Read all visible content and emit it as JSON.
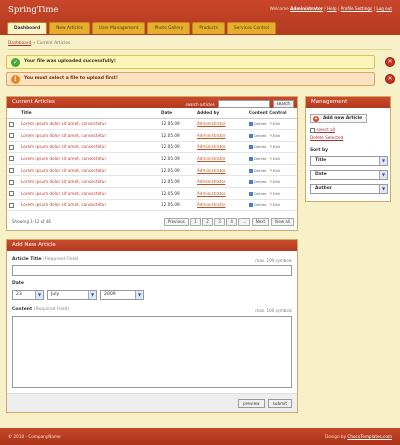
{
  "header": {
    "brand": "SpringTime",
    "welcome": "Welcome",
    "user": "Administrator",
    "sep": "|",
    "links": [
      "Help",
      "Profile Settings",
      "Log out"
    ]
  },
  "nav": {
    "tabs": [
      {
        "label": "Dashboard",
        "active": true
      },
      {
        "label": "New Articles",
        "active": false
      },
      {
        "label": "User Management",
        "active": false
      },
      {
        "label": "Photo Gallery",
        "active": false
      },
      {
        "label": "Products",
        "active": false
      },
      {
        "label": "Services Control",
        "active": false
      }
    ]
  },
  "breadcrumb": {
    "root": "Dashboard",
    "sep": "»",
    "current": "Current Articles"
  },
  "messages": {
    "success": "Your file was uploaded successfully!",
    "error": "You must select a file to upload first!",
    "ok_glyph": "✓",
    "err_glyph": "!",
    "close_glyph": "✕"
  },
  "articles": {
    "title": "Current Articles",
    "search_label": "search articles",
    "search_button": "search",
    "columns": [
      "Title",
      "Date",
      "Added by",
      "Content Control"
    ],
    "delete_label": "Delete",
    "edit_label": "Edit",
    "rows": [
      {
        "title": "Lorem ipsum dolor sit amet, consectetur",
        "date": "12.05.09",
        "author": "Administrator"
      },
      {
        "title": "Lorem ipsum dolor sit amet, consectetur",
        "date": "12.05.09",
        "author": "Administrator"
      },
      {
        "title": "Lorem ipsum dolor sit amet, consectetur",
        "date": "12.05.09",
        "author": "Administrator"
      },
      {
        "title": "Lorem ipsum dolor sit amet, consectetur",
        "date": "12.05.09",
        "author": "Administrator"
      },
      {
        "title": "Lorem ipsum dolor sit amet, consectetur",
        "date": "12.05.09",
        "author": "Administrator"
      },
      {
        "title": "Lorem ipsum dolor sit amet, consectetur",
        "date": "12.05.09",
        "author": "Administrator"
      },
      {
        "title": "Lorem ipsum dolor sit amet, consectetur",
        "date": "12.05.09",
        "author": "Administrator"
      },
      {
        "title": "Lorem ipsum dolor sit amet, consectetur",
        "date": "12.05.09",
        "author": "Administrator"
      }
    ],
    "pager_info": "Showing 1-12 of 48",
    "pager_buttons": [
      "Previous",
      "1",
      "2",
      "3",
      "4",
      "...",
      "Next",
      "View all"
    ]
  },
  "management": {
    "title": "Management",
    "add_button": "Add new Article",
    "select_all": "select all",
    "delete_selected": "Delete Selected",
    "sort_by": "Sort by",
    "sort_options": [
      "Title",
      "Date",
      "Author"
    ]
  },
  "add_article": {
    "title": "Add New Article",
    "title_label": "Article Title",
    "title_req": "(Required Field)",
    "title_max": "max. 100 symbols",
    "date_label": "Date",
    "date_day": "23",
    "date_month": "July",
    "date_year": "2009",
    "content_label": "Content",
    "content_req": "(Required Field)",
    "content_max": "max. 100 symbols",
    "preview_button": "preview",
    "submit_button": "submit"
  },
  "footer": {
    "copyright": "© 2010 - CompanyName",
    "design_by": "Design by",
    "design_link": "ChocoTemplates.com"
  },
  "colors": {
    "header": "#c8462a",
    "tab": "#e6ae2f",
    "background": "#f8f1c8"
  }
}
